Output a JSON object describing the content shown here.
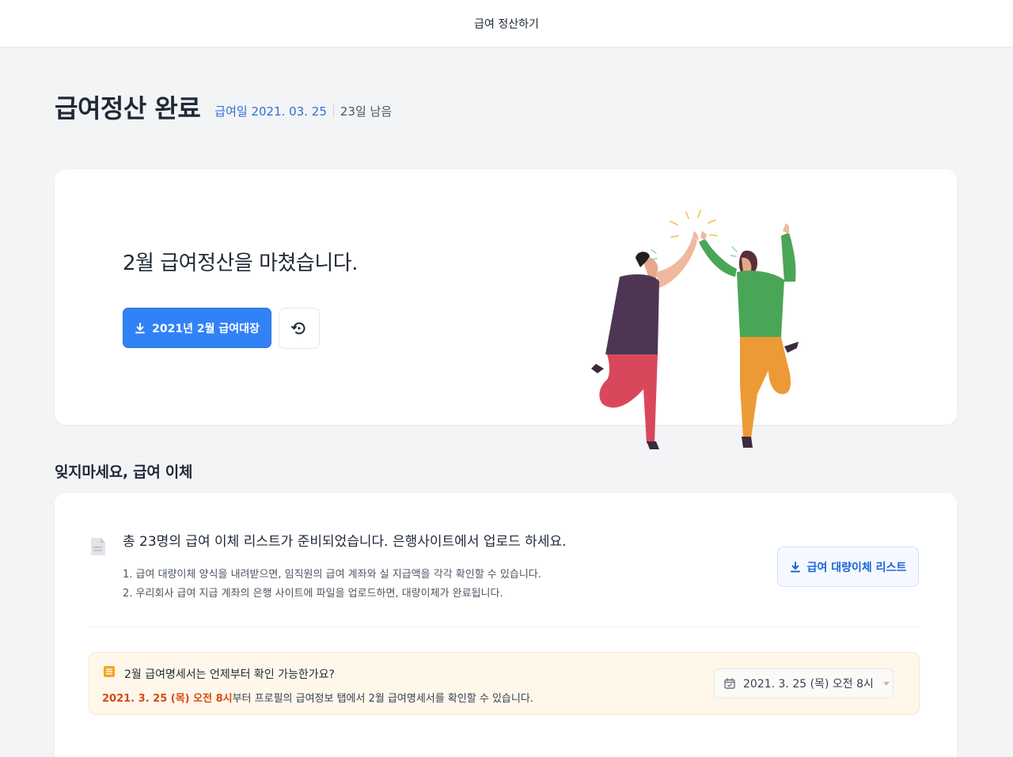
{
  "topbar": {
    "title": "급여 정산하기"
  },
  "header": {
    "title": "급여정산 완료",
    "pay_date": "급여일 2021. 03. 25",
    "remaining": "23일 남음"
  },
  "hero": {
    "message": "2월 급여정산을 마쳤습니다.",
    "download_label": "2021년 2월 급여대장",
    "download_icon": "download-icon",
    "reset_icon": "history-icon"
  },
  "reminder": {
    "section_title": "잊지마세요, 급여 이체",
    "headline": "총 23명의 급여 이체 리스트가 준비되었습니다. 은행사이트에서 업로드 하세요.",
    "steps": [
      "1. 급여 대량이체 양식을 내려받으면, 임직원의 급여 계좌와 실 지급액을 각각 확인할 수 있습니다.",
      "2. 우리회사 급여 지급 계좌의 은행 사이트에 파일을 업로드하면, 대량이체가 완료됩니다."
    ],
    "download_list_label": "급여 대량이체 리스트"
  },
  "notice": {
    "question": "2월 급여명세서는 언제부터 확인 가능한가요?",
    "answer_highlight": "2021. 3. 25 (목) 오전 8시",
    "answer_rest": "부터 프로필의 급여정보 탭에서 2월 급여명세서를 확인할 수 있습니다.",
    "date_value": "2021. 3. 25 (목) 오전 8시"
  },
  "colors": {
    "primary": "#3182f6",
    "highlight": "#d9480f",
    "notice_bg": "#fff7ea"
  }
}
